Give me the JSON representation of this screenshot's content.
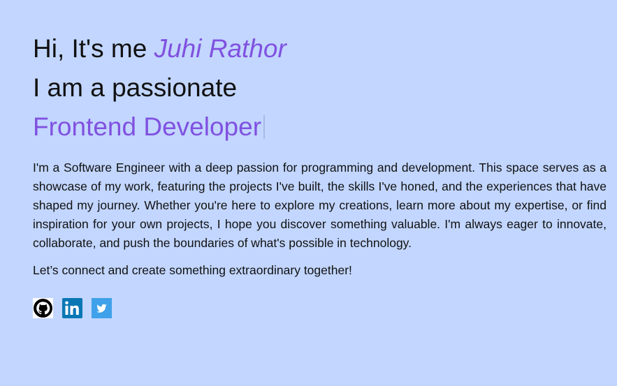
{
  "hero": {
    "greeting": "Hi, It's me ",
    "name": "Juhi Rathor",
    "intro": "I am a passionate",
    "role": "Frontend Developer",
    "bio": "I'm a Software Engineer with a deep passion for programming and development. This space serves as a showcase of my work, featuring the projects I've built, the skills I've honed, and the experiences that have shaped my journey. Whether you're here to explore my creations, learn more about my expertise, or find inspiration for your own projects, I hope you discover something valuable. I'm always eager to innovate, collaborate, and push the boundaries of what's possible in technology.",
    "cta": "Let’s connect and create something extraordinary together!"
  },
  "socials": [
    {
      "icon": "github-icon"
    },
    {
      "icon": "linkedin-icon"
    },
    {
      "icon": "twitter-icon"
    }
  ],
  "colors": {
    "background": "#c2d6ff",
    "accent": "#8051e0",
    "linkedin": "#0a77b5",
    "twitter": "#3fa1ea"
  }
}
